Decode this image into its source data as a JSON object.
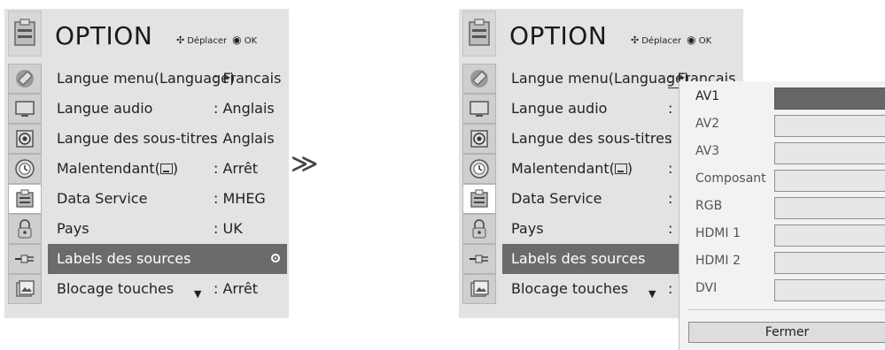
{
  "title": "OPTION",
  "hint": {
    "move_label": "Déplacer",
    "ok_label": "OK"
  },
  "menu": [
    {
      "label": "Langue menu(Language)",
      "value": ": Francais"
    },
    {
      "label": "Langue audio",
      "value": ": Anglais"
    },
    {
      "label": "Langue des sous-titres",
      "value": ": Anglais"
    },
    {
      "label": "Malentendant(",
      "value": ": Arrêt"
    },
    {
      "label": "Data Service",
      "value": ": MHEG"
    },
    {
      "label": "Pays",
      "value": ": UK"
    },
    {
      "label": "Labels des sources",
      "value": ""
    },
    {
      "label": "Blocage touches",
      "value": ": Arrêt"
    }
  ],
  "right_menu_values": [
    ": Francais",
    ":",
    ":",
    ":",
    ":",
    ":",
    "",
    ":"
  ],
  "sources": [
    "AV1",
    "AV2",
    "AV3",
    "Composant",
    "RGB",
    "HDMI 1",
    "HDMI 2",
    "DVI"
  ],
  "close_label": "Fermer",
  "separator": "≫",
  "colors": {
    "panel_bg": "#e3e3e3",
    "highlight": "#6b6b6b"
  }
}
